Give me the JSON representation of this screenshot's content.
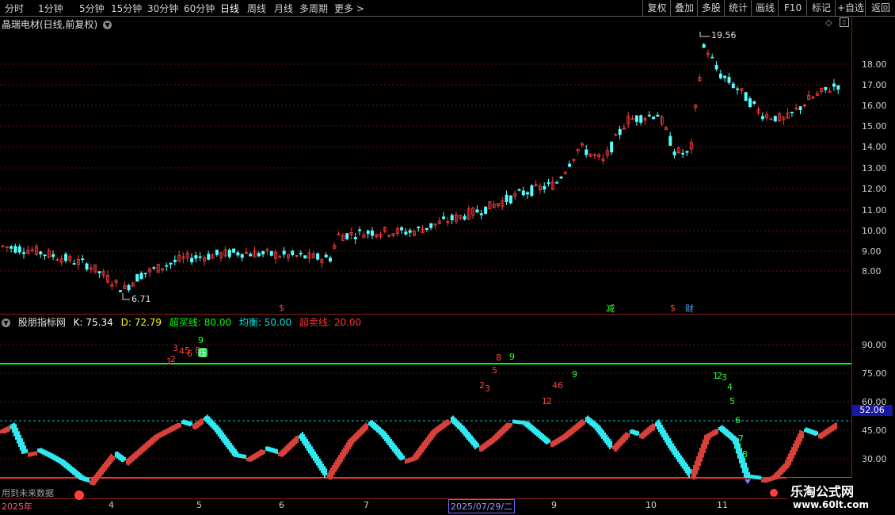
{
  "toolbar": {
    "periods": [
      "分时",
      "1分钟",
      "5分钟",
      "15分钟",
      "30分钟",
      "60分钟",
      "日线",
      "周线",
      "月线",
      "多周期",
      "更多 >"
    ],
    "active_period": "日线",
    "buttons": [
      "复权",
      "叠加",
      "多股",
      "统计",
      "画线",
      "F10",
      "+自选",
      "返回"
    ]
  },
  "stock": {
    "title": "晶瑞电材(日线,前复权)"
  },
  "price_axis": {
    "labels": [
      "18.00",
      "17.00",
      "16.00",
      "15.00",
      "14.00",
      "13.00",
      "12.00",
      "11.00",
      "10.00",
      "9.00",
      "8.00"
    ]
  },
  "price_annotations": {
    "high": "19.56",
    "low": "6.71"
  },
  "indicator": {
    "name": "股朋指标网",
    "k_label": "K: 75.34",
    "d_label": "D: 72.79",
    "overbuy_label": "超买线: 80.00",
    "mid_label": "均衡: 50.00",
    "oversell_label": "超卖线: 20.00",
    "axis_labels": [
      "90.00",
      "75.00",
      "60.00",
      "45.00",
      "30.00"
    ],
    "current_value": "52.06",
    "colors": {
      "k": "#ffffff",
      "d": "#ffff00",
      "overbuy": "#00ff00",
      "mid": "#00e0e0",
      "oversell": "#ff3030"
    }
  },
  "time_axis": {
    "labels": [
      "2025年",
      "4",
      "5",
      "6",
      "7",
      "9",
      "10",
      "11"
    ],
    "selected_date": "2025/07/29/二"
  },
  "markers": {
    "jian": "减",
    "cai": "财",
    "ya": "压"
  },
  "future_data": "用到未来数据",
  "watermark": {
    "name": "乐淘公式网",
    "url": "www.60lt.com"
  }
}
